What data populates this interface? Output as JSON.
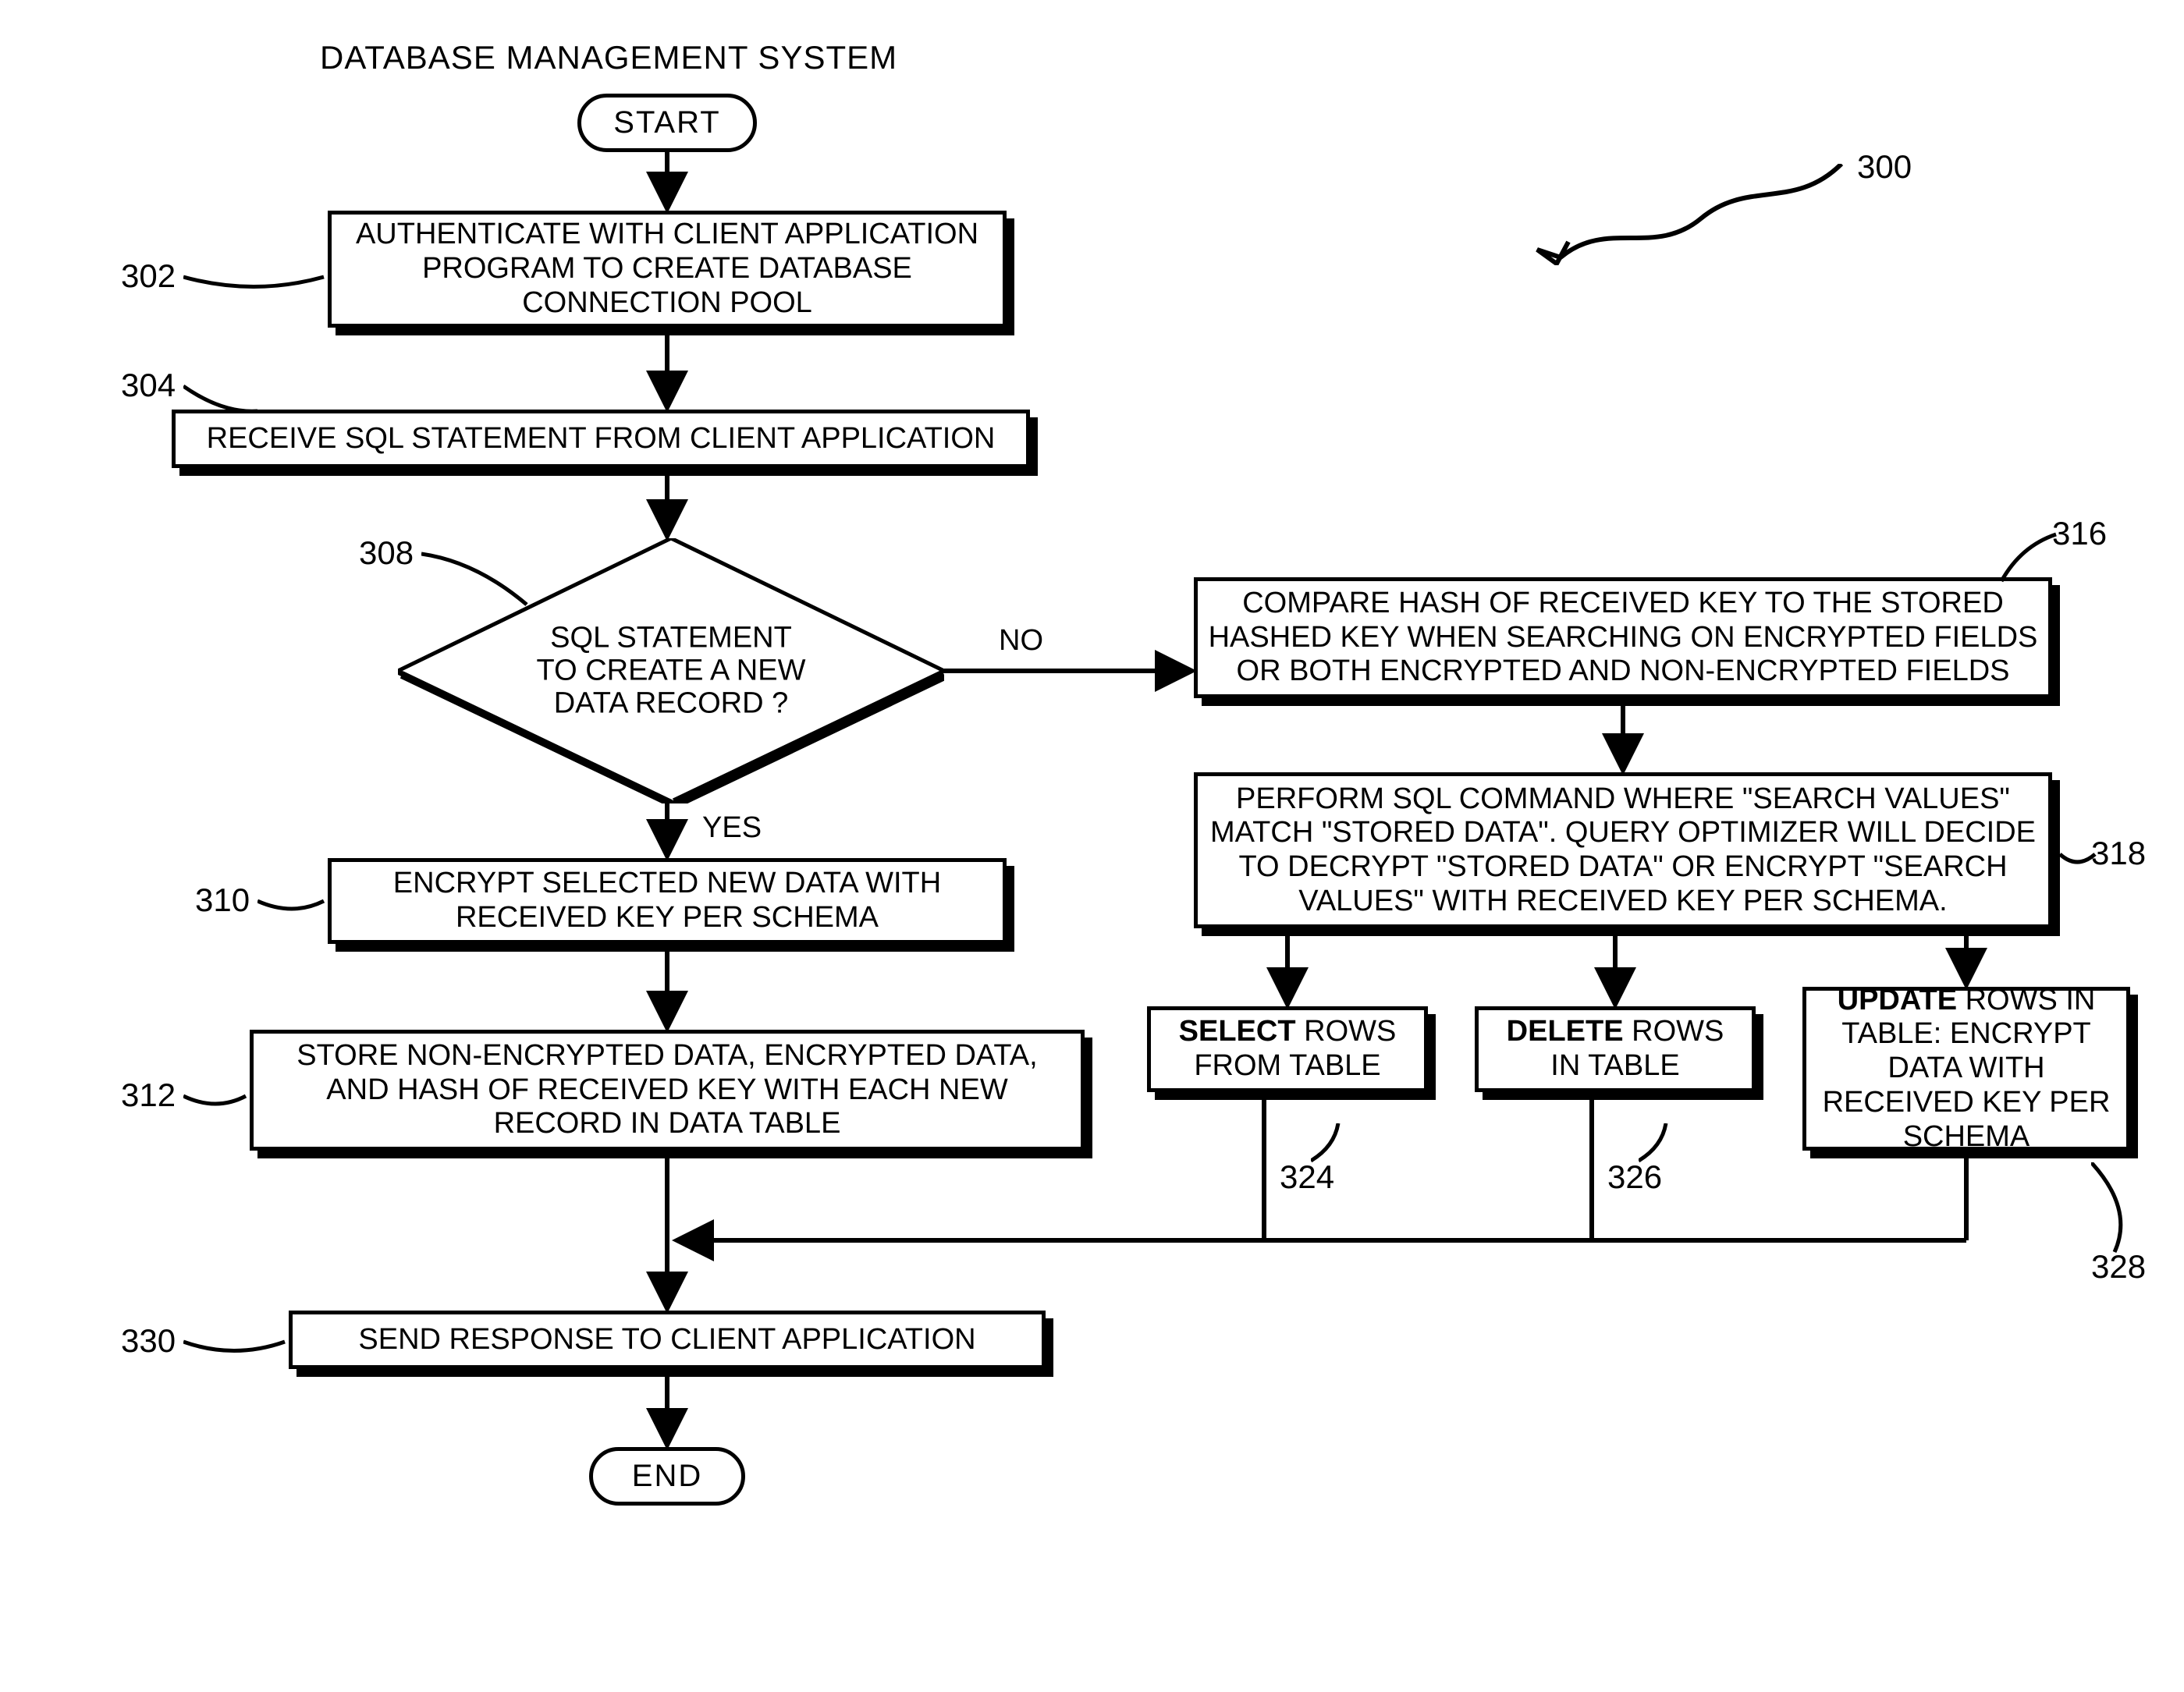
{
  "title": "DATABASE MANAGEMENT SYSTEM",
  "figure_ref": "300",
  "terminals": {
    "start": "START",
    "end": "END"
  },
  "boxes": {
    "b302": "AUTHENTICATE WITH CLIENT APPLICATION PROGRAM TO CREATE DATABASE CONNECTION POOL",
    "b304": "RECEIVE SQL STATEMENT FROM CLIENT APPLICATION",
    "b310": "ENCRYPT SELECTED NEW DATA WITH RECEIVED KEY PER SCHEMA",
    "b312": "STORE NON-ENCRYPTED DATA, ENCRYPTED DATA, AND HASH OF RECEIVED KEY WITH EACH NEW RECORD IN DATA TABLE",
    "b316": "COMPARE HASH OF RECEIVED KEY TO THE STORED HASHED KEY WHEN SEARCHING ON ENCRYPTED FIELDS OR BOTH ENCRYPTED AND NON-ENCRYPTED FIELDS",
    "b318": "PERFORM SQL COMMAND WHERE \"SEARCH VALUES\" MATCH \"STORED DATA\". QUERY OPTIMIZER WILL DECIDE TO DECRYPT \"STORED DATA\" OR ENCRYPT \"SEARCH VALUES\" WITH RECEIVED KEY PER SCHEMA.",
    "b324_bold": "SELECT",
    "b324_rest": " ROWS FROM TABLE",
    "b326_bold": "DELETE",
    "b326_rest": " ROWS IN TABLE",
    "b328_bold": "UPDATE",
    "b328_rest": " ROWS IN TABLE: ENCRYPT DATA WITH RECEIVED KEY PER SCHEMA",
    "b330": "SEND RESPONSE TO CLIENT APPLICATION"
  },
  "diamond": {
    "d308": "SQL STATEMENT\nTO CREATE A NEW\nDATA RECORD ?"
  },
  "edges": {
    "yes": "YES",
    "no": "NO"
  },
  "refs": {
    "r302": "302",
    "r304": "304",
    "r308": "308",
    "r310": "310",
    "r312": "312",
    "r316": "316",
    "r318": "318",
    "r324": "324",
    "r326": "326",
    "r328": "328",
    "r330": "330"
  }
}
